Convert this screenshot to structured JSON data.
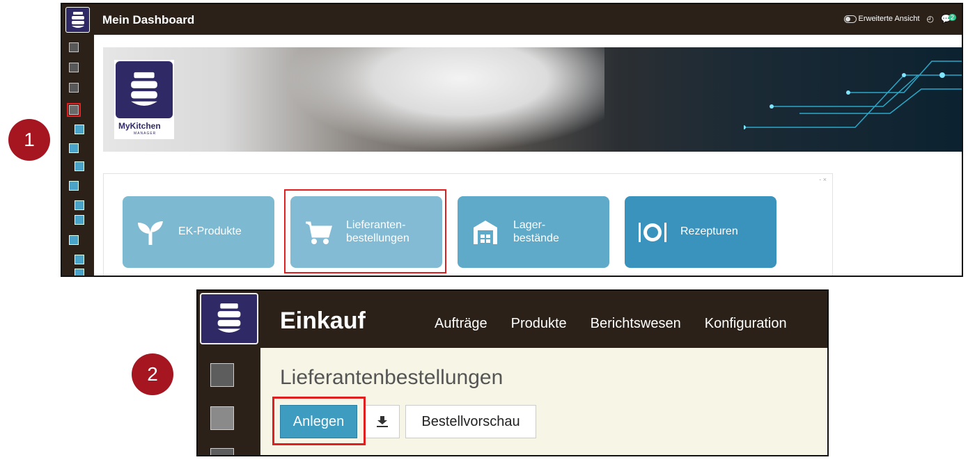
{
  "steps": [
    "1",
    "2"
  ],
  "screen1": {
    "header_title": "Mein Dashboard",
    "extended_view_label": "Erweiterte Ansicht",
    "notification_count": "2",
    "banner": {
      "brand_name": "MyKitchen",
      "brand_subtitle": "MANAGER"
    },
    "widget_controls": "- ×",
    "tiles": [
      {
        "line1": "EK-Produkte",
        "line2": "",
        "color": "#7dbad1"
      },
      {
        "line1": "Lieferanten-",
        "line2": "bestellungen",
        "color": "#82bbd3"
      },
      {
        "line1": "Lager-",
        "line2": "bestände",
        "color": "#5eaac8"
      },
      {
        "line1": "Rezepturen",
        "line2": "",
        "color": "#3a93bd"
      }
    ]
  },
  "screen2": {
    "header_title": "Einkauf",
    "menu": [
      "Aufträge",
      "Produkte",
      "Berichtswesen",
      "Konfiguration"
    ],
    "page_title": "Lieferantenbestellungen",
    "buttons": {
      "create": "Anlegen",
      "preview": "Bestellvorschau"
    }
  },
  "colors": {
    "header": "#2b2118",
    "brand": "#2f2a66",
    "highlight": "#e02020",
    "step": "#a51621",
    "accent": "#3f9cc1"
  }
}
